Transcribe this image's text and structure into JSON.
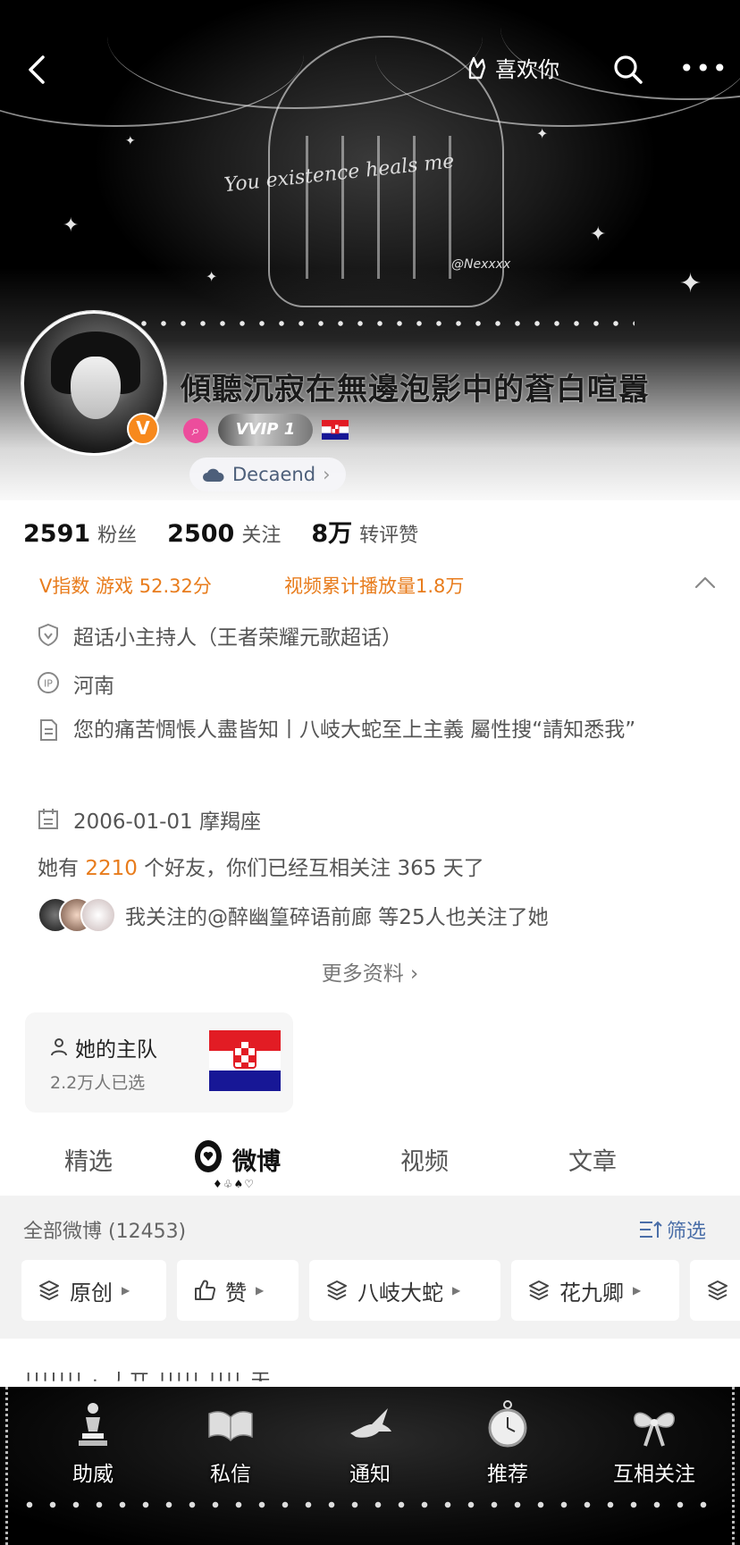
{
  "header": {
    "like_label": "喜欢你",
    "banner_script": "You existence heals me",
    "banner_watermark": "@Nexxxx"
  },
  "profile": {
    "name": "傾聽沉寂在無邊泡影中的蒼白喧囂",
    "vip_badge": "VVIP 1",
    "link_label": "Decaend",
    "verified_mark": "V"
  },
  "stats": [
    {
      "num": "2591",
      "label": "粉丝"
    },
    {
      "num": "2500",
      "label": "关注"
    },
    {
      "num": "8万",
      "label": "转评赞"
    }
  ],
  "info": {
    "v_index": "V指数 游戏 52.32分",
    "video_plays": "视频累计播放量1.8万",
    "supertopic": "超话小主持人（王者荣耀元歌超话）",
    "ip_location": "河南",
    "bio": "您的痛苦惆悵人盡皆知丨八岐大蛇至上主義 屬性搜“請知悉我”",
    "birthday": "2006-01-01 摩羯座",
    "friends_prefix": "她有 ",
    "friends_count": "2210",
    "friends_suffix": " 个好友，你们已经互相关注 365 天了",
    "mutual_follow": "我关注的@醉幽篁碎语前廊  等25人也关注了她",
    "more_info": "更多资料"
  },
  "team": {
    "title": "她的主队",
    "subtitle": "2.2万人已选"
  },
  "tabs": [
    "精选",
    "微博",
    "视频",
    "文章"
  ],
  "tab_suits": "♦♧♠♡",
  "feed": {
    "count_label": "全部微博 (12453)",
    "filter_label": "筛选",
    "chips": [
      "原创",
      "赞",
      "八岐大蛇",
      "花九卿"
    ],
    "partial_line": "||||||| · 丿丌 ||||| |||| 天"
  },
  "bottom_nav": [
    "助威",
    "私信",
    "通知",
    "推荐",
    "互相关注"
  ],
  "colors": {
    "accent_orange": "#e87c1c",
    "link_blue": "#4a6ea8",
    "verified_orange": "#f7891d"
  }
}
